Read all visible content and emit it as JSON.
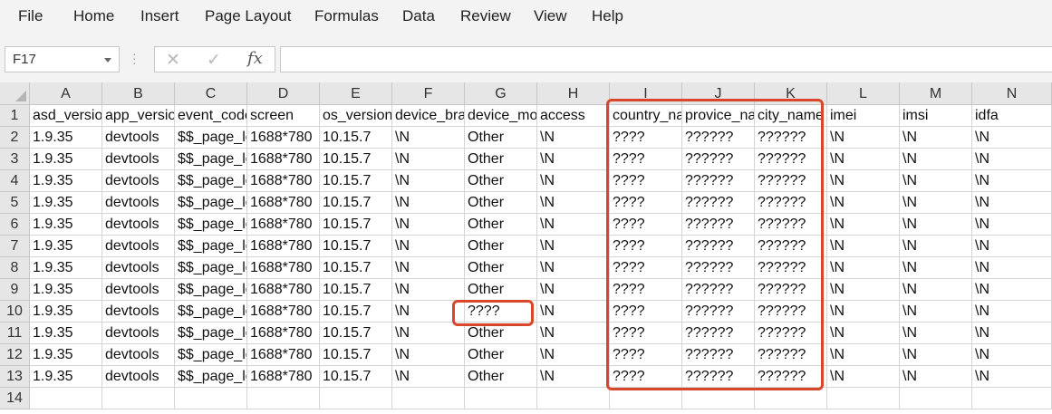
{
  "menu": {
    "items": [
      "File",
      "Home",
      "Insert",
      "Page Layout",
      "Formulas",
      "Data",
      "Review",
      "View",
      "Help"
    ]
  },
  "formula_bar": {
    "name_box": "F17",
    "formula": "",
    "icons": [
      "cancel-icon",
      "enter-icon",
      "insert-function-icon"
    ],
    "fx_label": "fx"
  },
  "sheet": {
    "columns": [
      "A",
      "B",
      "C",
      "D",
      "E",
      "F",
      "G",
      "H",
      "I",
      "J",
      "K",
      "L",
      "M",
      "N"
    ],
    "row_numbers": [
      "1",
      "2",
      "3",
      "4",
      "5",
      "6",
      "7",
      "8",
      "9",
      "10",
      "11",
      "12",
      "13",
      "14"
    ],
    "rows": [
      [
        "asd_version",
        "app_version",
        "event_code",
        "screen",
        "os_version",
        "device_brand",
        "device_model",
        "access",
        "country_name",
        "provice_name",
        "city_name",
        "imei",
        "imsi",
        "idfa"
      ],
      [
        "1.9.35",
        "devtools",
        "$$_page_leave",
        "1688*780",
        "10.15.7",
        "\\N",
        "Other",
        "\\N",
        "????",
        "??????",
        "??????",
        "\\N",
        "\\N",
        "\\N"
      ],
      [
        "1.9.35",
        "devtools",
        "$$_page_leave",
        "1688*780",
        "10.15.7",
        "\\N",
        "Other",
        "\\N",
        "????",
        "??????",
        "??????",
        "\\N",
        "\\N",
        "\\N"
      ],
      [
        "1.9.35",
        "devtools",
        "$$_page_leave",
        "1688*780",
        "10.15.7",
        "\\N",
        "Other",
        "\\N",
        "????",
        "??????",
        "??????",
        "\\N",
        "\\N",
        "\\N"
      ],
      [
        "1.9.35",
        "devtools",
        "$$_page_leave",
        "1688*780",
        "10.15.7",
        "\\N",
        "Other",
        "\\N",
        "????",
        "??????",
        "??????",
        "\\N",
        "\\N",
        "\\N"
      ],
      [
        "1.9.35",
        "devtools",
        "$$_page_leave",
        "1688*780",
        "10.15.7",
        "\\N",
        "Other",
        "\\N",
        "????",
        "??????",
        "??????",
        "\\N",
        "\\N",
        "\\N"
      ],
      [
        "1.9.35",
        "devtools",
        "$$_page_leave",
        "1688*780",
        "10.15.7",
        "\\N",
        "Other",
        "\\N",
        "????",
        "??????",
        "??????",
        "\\N",
        "\\N",
        "\\N"
      ],
      [
        "1.9.35",
        "devtools",
        "$$_page_leave",
        "1688*780",
        "10.15.7",
        "\\N",
        "Other",
        "\\N",
        "????",
        "??????",
        "??????",
        "\\N",
        "\\N",
        "\\N"
      ],
      [
        "1.9.35",
        "devtools",
        "$$_page_leave",
        "1688*780",
        "10.15.7",
        "\\N",
        "Other",
        "\\N",
        "????",
        "??????",
        "??????",
        "\\N",
        "\\N",
        "\\N"
      ],
      [
        "1.9.35",
        "devtools",
        "$$_page_leave",
        "1688*780",
        "10.15.7",
        "\\N",
        "????",
        "\\N",
        "????",
        "??????",
        "??????",
        "\\N",
        "\\N",
        "\\N"
      ],
      [
        "1.9.35",
        "devtools",
        "$$_page_leave",
        "1688*780",
        "10.15.7",
        "\\N",
        "Other",
        "\\N",
        "????",
        "??????",
        "??????",
        "\\N",
        "\\N",
        "\\N"
      ],
      [
        "1.9.35",
        "devtools",
        "$$_page_leave",
        "1688*780",
        "10.15.7",
        "\\N",
        "Other",
        "\\N",
        "????",
        "??????",
        "??????",
        "\\N",
        "\\N",
        "\\N"
      ],
      [
        "1.9.35",
        "devtools",
        "$$_page_leave",
        "1688*780",
        "10.15.7",
        "\\N",
        "Other",
        "\\N",
        "????",
        "??????",
        "??????",
        "\\N",
        "\\N",
        "\\N"
      ],
      [
        "",
        "",
        "",
        "",
        "",
        "",
        "",
        "",
        "",
        "",
        "",
        "",
        "",
        ""
      ]
    ]
  },
  "colors": {
    "highlight": "#d9472b",
    "header_bg": "#e6e6e6",
    "ribbon_bg": "#f3f3f3"
  }
}
